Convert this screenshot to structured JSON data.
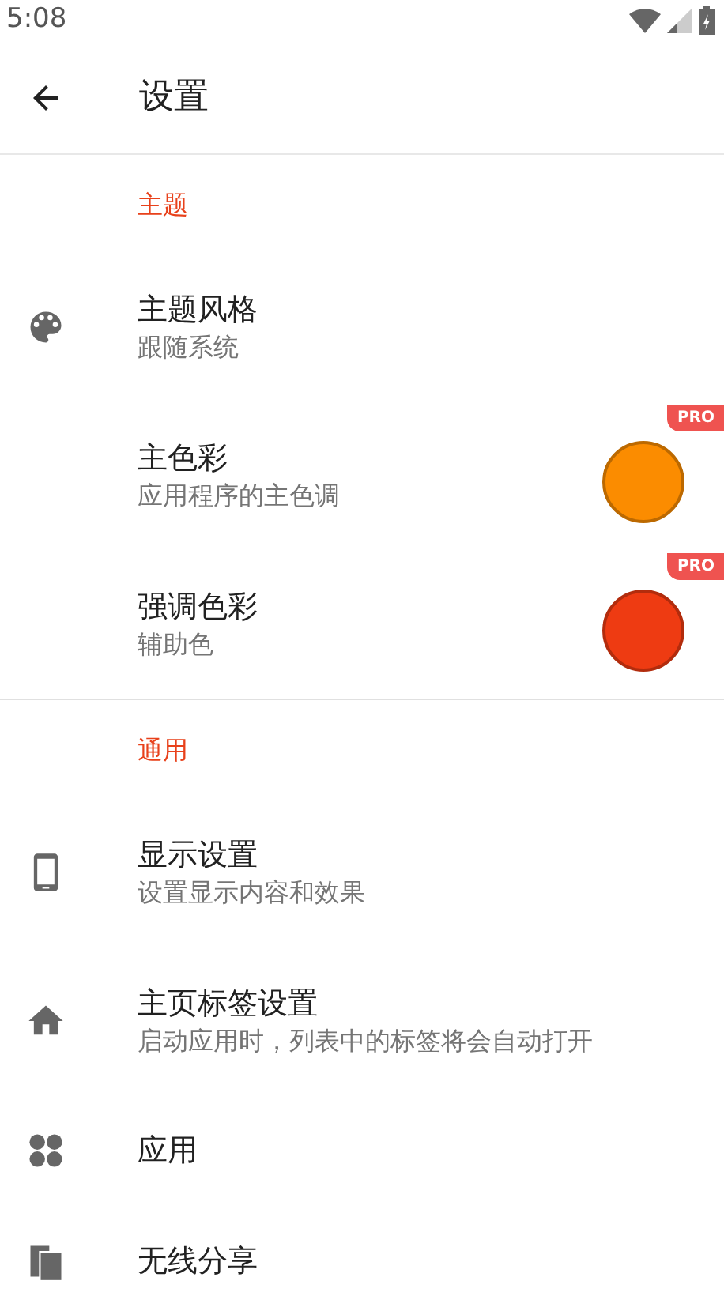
{
  "status_bar": {
    "time": "5:08"
  },
  "toolbar": {
    "title": "设置"
  },
  "sections": [
    {
      "header": "主题",
      "items": [
        {
          "kind": "plain",
          "title": "主题风格",
          "subtitle": "跟随系统"
        },
        {
          "kind": "color",
          "title": "主色彩",
          "subtitle": "应用程序的主色调",
          "color": "#fb8c00",
          "badge": "PRO"
        },
        {
          "kind": "color",
          "title": "强调色彩",
          "subtitle": "辅助色",
          "color": "#ee3b12",
          "badge": "PRO"
        }
      ]
    },
    {
      "header": "通用",
      "items": [
        {
          "kind": "plain",
          "title": "显示设置",
          "subtitle": "设置显示内容和效果"
        },
        {
          "kind": "plain",
          "title": "主页标签设置",
          "subtitle": "启动应用时，列表中的标签将会自动打开"
        },
        {
          "kind": "plain",
          "title": "应用"
        },
        {
          "kind": "plain",
          "title": "无线分享"
        }
      ]
    }
  ]
}
